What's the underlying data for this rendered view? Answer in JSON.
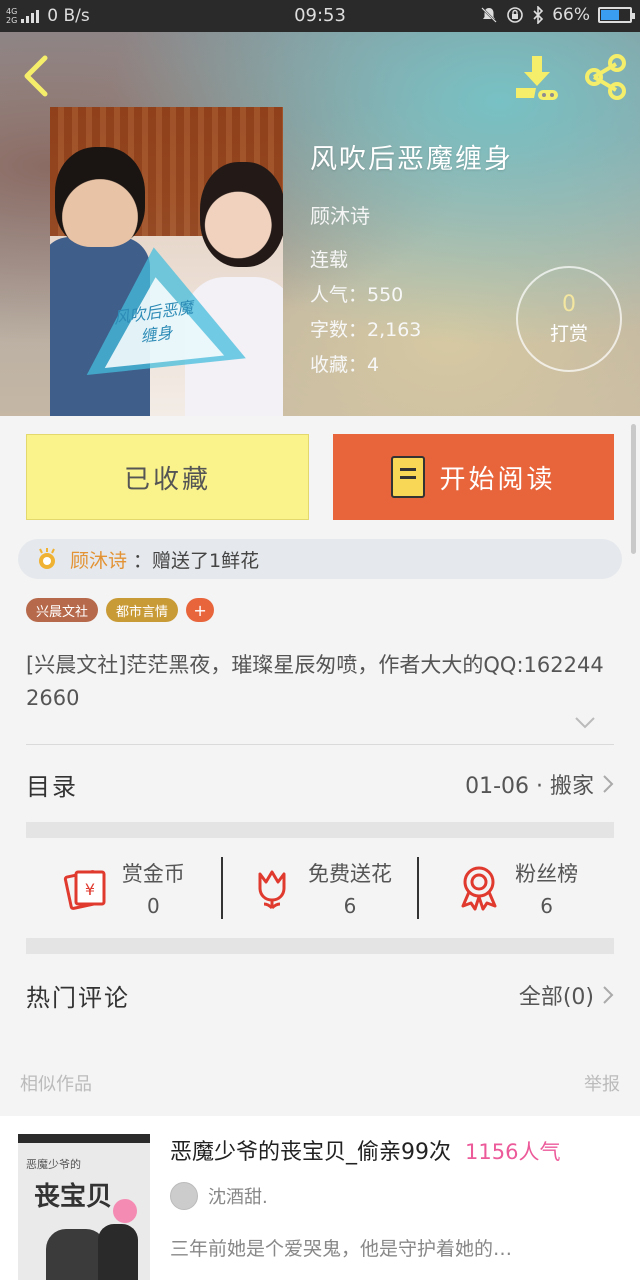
{
  "status_bar": {
    "network_top": "4G",
    "network_bottom": "2G",
    "speed": "0 B/s",
    "time": "09:53",
    "battery": "66%",
    "battery_level": 0.66,
    "battery_color": "#3a9df0"
  },
  "hero": {
    "cover_title": "风吹后恶魔缠身",
    "title": "风吹后恶魔缠身",
    "author": "顾沐诗",
    "status": "连载",
    "popularity": "人气：550",
    "word_count": "字数：2,163",
    "favorites": "收藏：4",
    "tip_count": "0",
    "tip_label": "打赏"
  },
  "actions": {
    "collected_label": "已收藏",
    "read_label": "开始阅读",
    "collected_color": "#faf38b",
    "read_color": "#e8653c"
  },
  "flower": {
    "name": "顾沐诗",
    "text": "：赠送了1鲜花"
  },
  "tags": [
    "兴晨文社",
    "都市言情"
  ],
  "tag_add": "+",
  "description": "[兴晨文社]茫茫黑夜，璀璨星辰匆喷，作者大大的QQ:1622442660",
  "toc": {
    "label": "目录",
    "latest": "01-06 · 搬家"
  },
  "stats": [
    {
      "label": "赏金币",
      "value": "0",
      "icon": "red-envelope-icon"
    },
    {
      "label": "免费送花",
      "value": "6",
      "icon": "flower-icon"
    },
    {
      "label": "粉丝榜",
      "value": "6",
      "icon": "medal-icon"
    }
  ],
  "comments": {
    "label": "热门评论",
    "all": "全部(0)"
  },
  "similar": {
    "header": "相似作品",
    "report": "举报",
    "items": [
      {
        "title": "恶魔少爷的丧宝贝_偷亲99次",
        "popularity": "1156人气",
        "author": "沈酒甜.",
        "description": "三年前她是个爱哭鬼，他是守护着她的…",
        "cover_small": "恶魔少爷的",
        "cover_title": "丧宝贝"
      }
    ]
  }
}
